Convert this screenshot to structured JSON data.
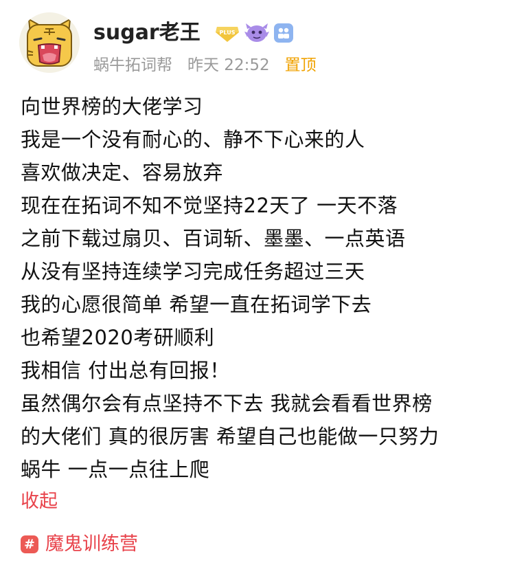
{
  "post": {
    "author": {
      "username": "sugar老王",
      "badges": [
        "plus-badge-icon",
        "monster-badge-icon",
        "group-badge-icon"
      ],
      "plus_badge_text": "PLUS"
    },
    "meta": {
      "source": "蜗牛拓词帮",
      "time": "昨天 22:52",
      "pinned_label": "置顶"
    },
    "body_lines": [
      "向世界榜的大佬学习",
      "我是一个没有耐心的、静不下心来的人",
      "喜欢做决定、容易放弃",
      "现在在拓词不知不觉坚持22天了 一天不落",
      "之前下载过扇贝、百词斩、墨墨、一点英语",
      "从没有坚持连续学习完成任务超过三天",
      "我的心愿很简单 希望一直在拓词学下去",
      "也希望2020考研顺利",
      "我相信 付出总有回报！",
      "虽然偶尔会有点坚持不下去 我就会看看世界榜",
      "的大佬们 真的很厉害 希望自己也能做一只努力",
      "蜗牛 一点一点往上爬"
    ],
    "collapse_label": "收起",
    "topic": {
      "icon_glyph": "#",
      "label": "魔鬼训练营"
    }
  },
  "colors": {
    "accent_red": "#e8434b",
    "pin_orange": "#f0a200",
    "meta_gray": "#9a9a9a",
    "plus_gold": "#f2c53d",
    "monster_purple": "#a98ce8",
    "group_blue": "#8eb4f0"
  }
}
